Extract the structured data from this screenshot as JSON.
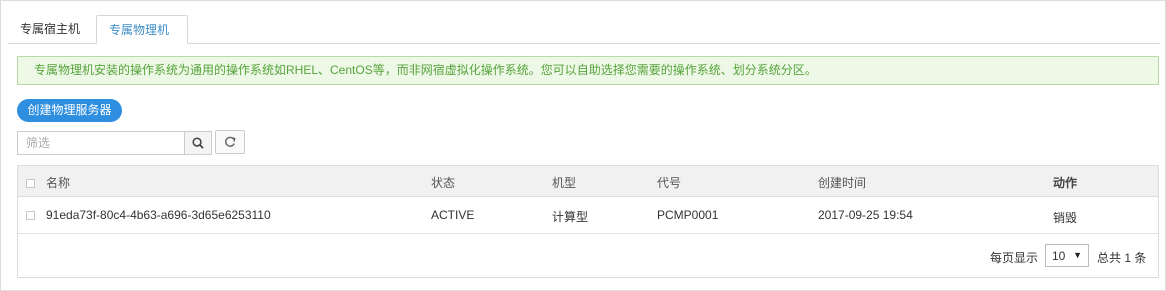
{
  "tabs": {
    "items": [
      {
        "label": "专属宿主机"
      },
      {
        "label": "专属物理机"
      }
    ]
  },
  "notice": {
    "text": "专属物理机安装的操作系统为通用的操作系统如RHEL、CentOS等，而非网宿虚拟化操作系统。您可以自助选择您需要的操作系统、划分系统分区。"
  },
  "toolbar": {
    "create_label": "创建物理服务器",
    "search_placeholder": "筛选",
    "search_icon": "search-icon",
    "refresh_icon": "refresh-icon"
  },
  "table": {
    "headers": {
      "name": "名称",
      "status": "状态",
      "type": "机型",
      "code": "代号",
      "created": "创建时间",
      "action": "动作"
    },
    "rows": [
      {
        "name": "91eda73f-80c4-4b63-a696-3d65e6253110",
        "status": "ACTIVE",
        "type": "计算型",
        "code": "PCMP0001",
        "created": "2017-09-25 19:54",
        "action": "销毁"
      }
    ]
  },
  "pagination": {
    "per_page_label": "每页显示",
    "per_page_value": "10",
    "total_label": "总共 1 条"
  },
  "colors": {
    "accent": "#2e8ee0",
    "link": "#3d8ec6",
    "notice_bg": "#eef8e6",
    "notice_text": "#57a33d"
  }
}
